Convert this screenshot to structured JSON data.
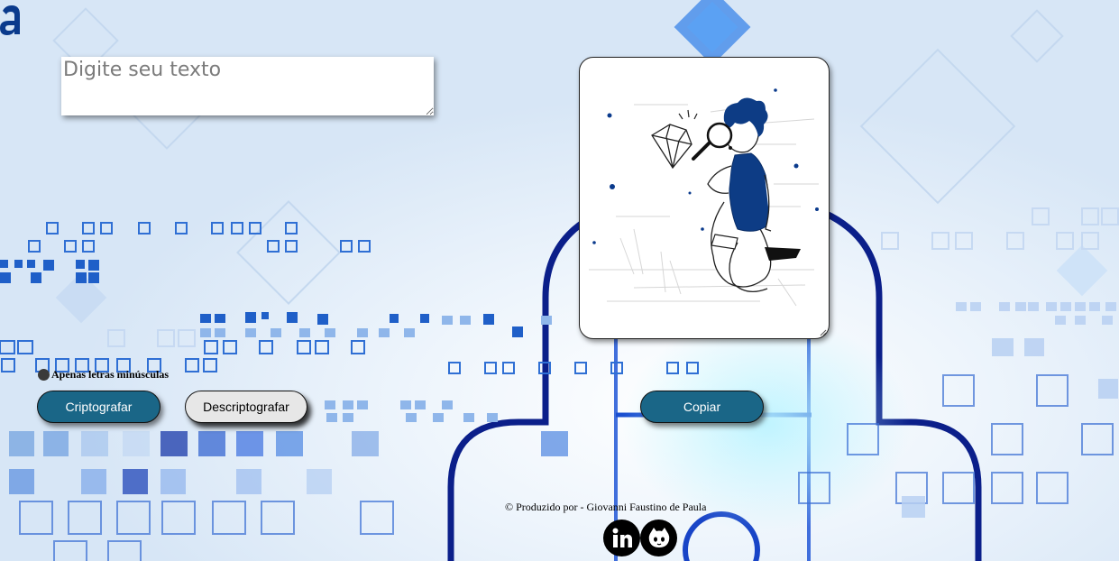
{
  "input": {
    "placeholder": "Digite seu texto"
  },
  "hint": {
    "text": "Apenas letras minúsculas",
    "icon": "info-icon"
  },
  "buttons": {
    "encrypt_label": "Criptografar",
    "decrypt_label": "Descriptografar",
    "copy_label": "Copiar"
  },
  "footer": {
    "credit": "© Produzido por - Giovanni Faustino de Paula"
  },
  "social": [
    {
      "icon": "linkedin-icon"
    },
    {
      "icon": "github-icon"
    }
  ],
  "output": {
    "illustration": "person-with-magnifier-illustration"
  },
  "colors": {
    "primary_button": "#1a6687",
    "secondary_button": "#e7e7e7",
    "accent_blue": "#0a3a8c"
  }
}
